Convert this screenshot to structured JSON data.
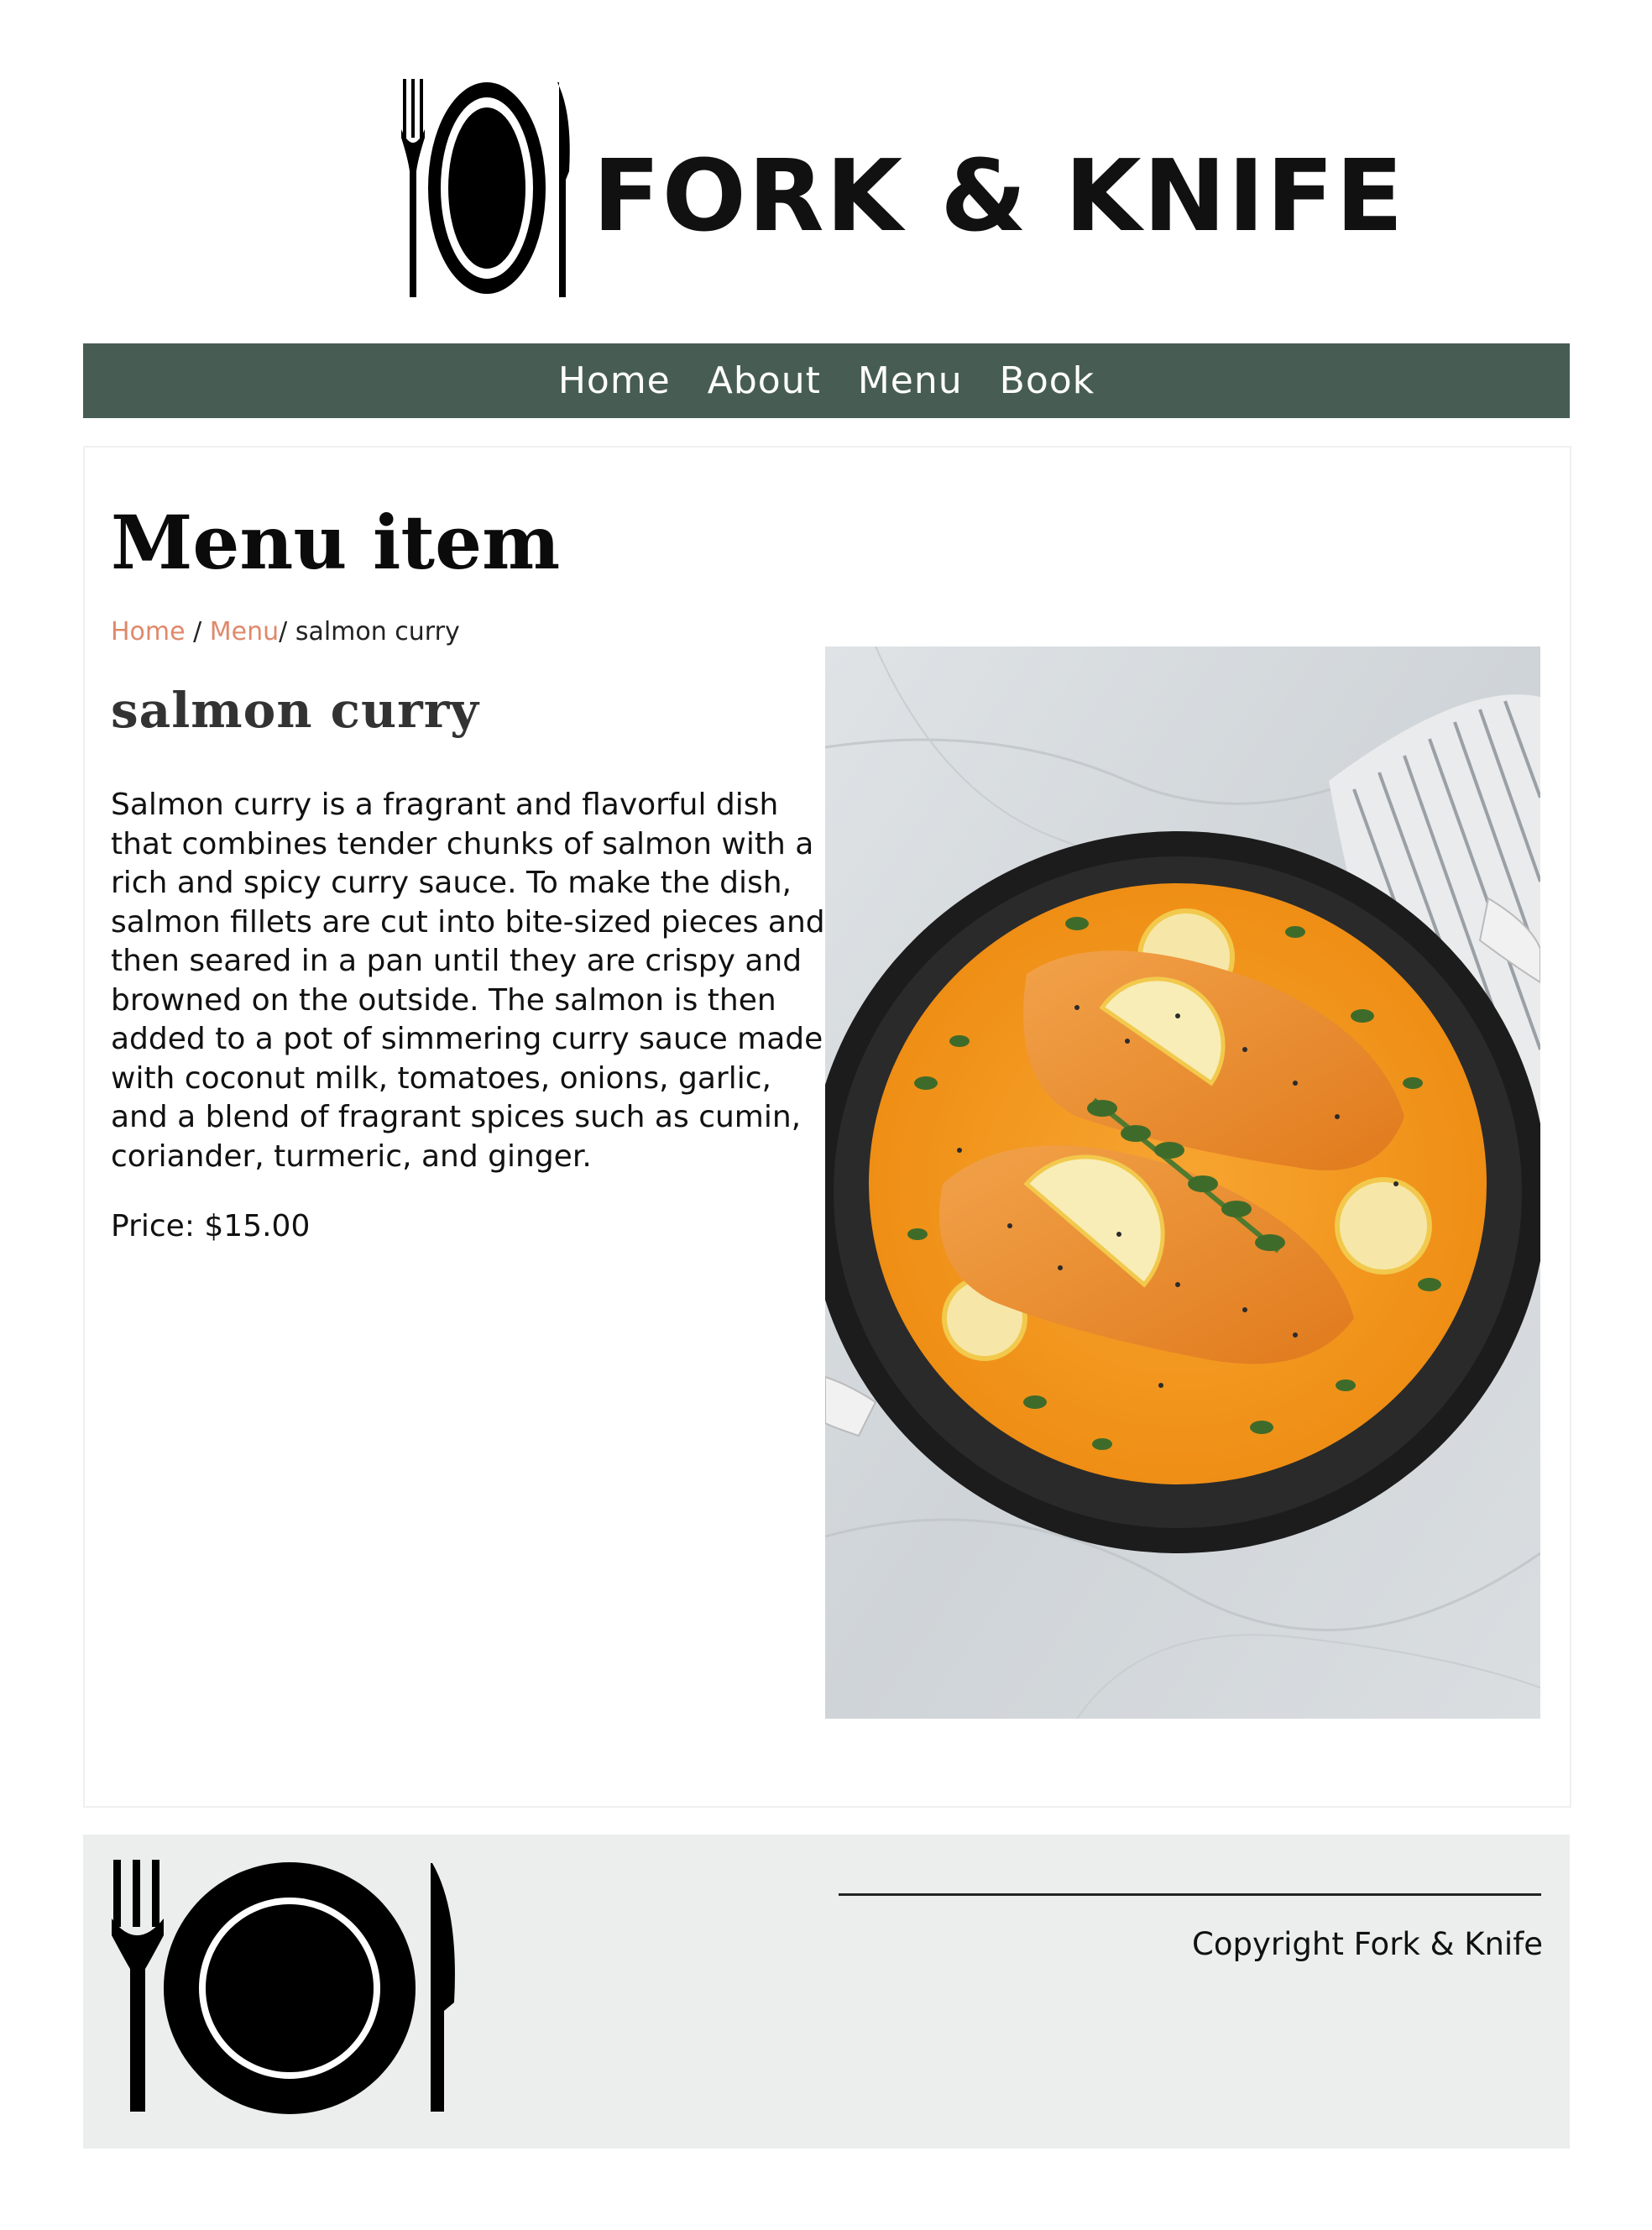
{
  "brand": {
    "name": "FORK & KNIFE",
    "logo_icon": "fork-plate-knife-icon"
  },
  "nav": {
    "items": [
      "Home",
      "About",
      "Menu",
      "Book"
    ]
  },
  "page": {
    "title": "Menu item"
  },
  "breadcrumb": {
    "home": "Home",
    "sep1": "/",
    "menu": "Menu",
    "current": "/ salmon curry"
  },
  "item": {
    "name": "salmon curry",
    "description": "Salmon curry is a fragrant and flavorful dish that combines tender chunks of salmon with a rich and spicy curry sauce. To make the dish, salmon fillets are cut into bite-sized pieces and then seared in a pan until they are crispy and browned on the outside. The salmon is then added to a pot of simmering curry sauce made with coconut milk, tomatoes, onions, garlic, and a blend of fragrant spices such as cumin, coriander, turmeric, and ginger.",
    "price": "Price: $15.00"
  },
  "footer": {
    "copyright": "Copyright Fork & Knife",
    "logo_icon": "fork-plate-knife-icon"
  },
  "colors": {
    "nav_bg": "#475d54",
    "link": "#e0886a",
    "footer_bg": "#eceeed",
    "curry": "#f39a1e"
  }
}
